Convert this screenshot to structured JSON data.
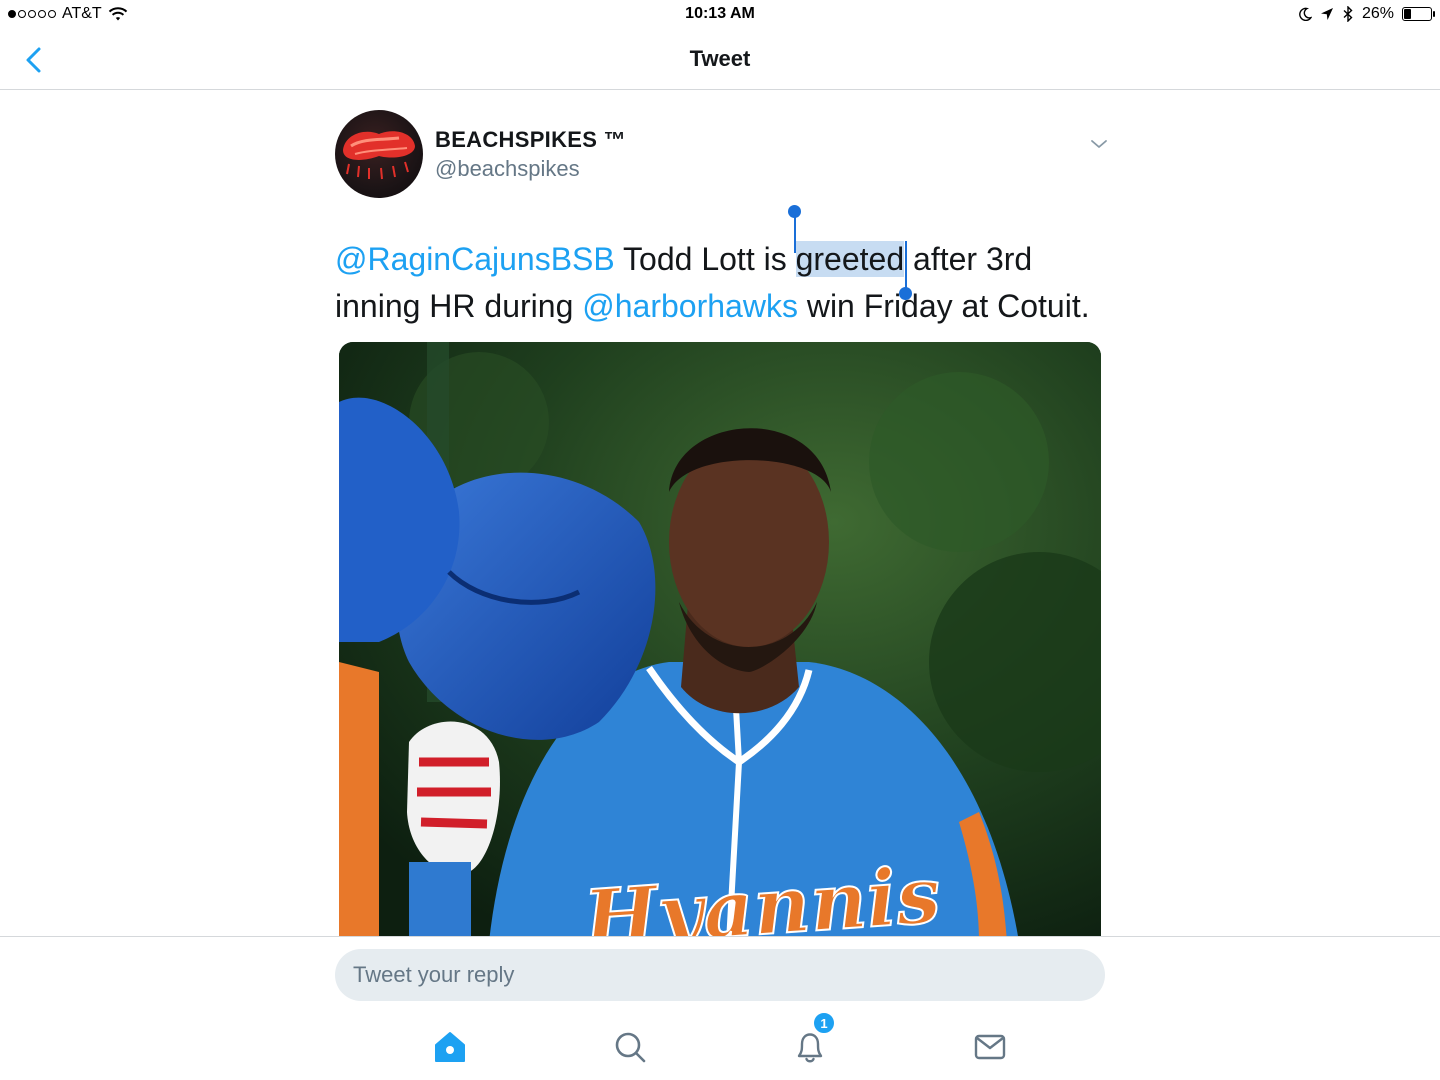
{
  "status_bar": {
    "carrier": "AT&T",
    "time": "10:13 AM",
    "battery_percent": "26%",
    "signal_bars_filled": 1,
    "battery_level": 0.26
  },
  "nav": {
    "title": "Tweet",
    "back_icon": "chevron-left-icon"
  },
  "tweet": {
    "display_name": "BEACHSPIKES ™",
    "handle": "@beachspikes",
    "text": {
      "mention1": "@RaginCajunsBSB",
      "part1": " Todd Lott is ",
      "selected_word": "greeted",
      "part2": " after 3rd inning HR during ",
      "mention2": "@harborhawks",
      "part3": " win Friday at Cotuit."
    },
    "media_jersey_text": "Hyannis"
  },
  "reply": {
    "placeholder": "Tweet your reply"
  },
  "tabs": [
    {
      "name": "home",
      "icon": "home-icon",
      "active": true
    },
    {
      "name": "search",
      "icon": "search-icon",
      "active": false
    },
    {
      "name": "notifications",
      "icon": "bell-icon",
      "active": false,
      "badge": "1"
    },
    {
      "name": "messages",
      "icon": "mail-icon",
      "active": false
    }
  ],
  "colors": {
    "accent": "#1da1f2",
    "selection": "#1a6fd8",
    "text": "#14171a",
    "muted": "#657786"
  }
}
